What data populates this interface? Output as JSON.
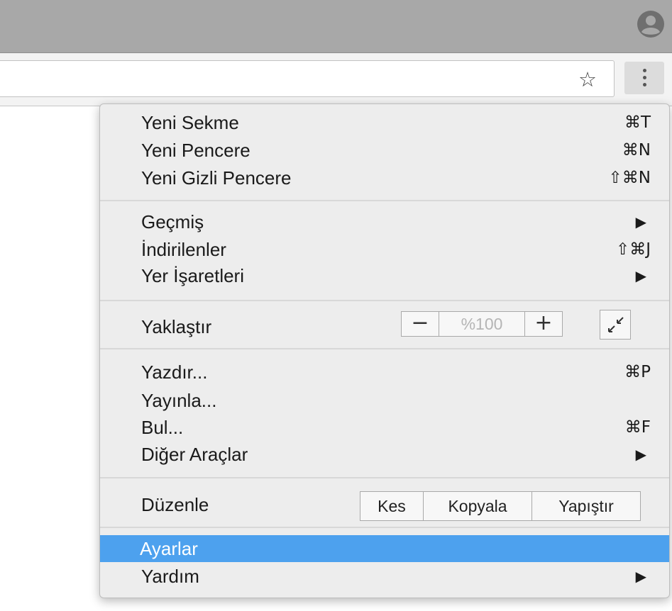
{
  "icons": {
    "profile": "account-circle-icon",
    "bookmark": "star-outline-icon",
    "menu": "vertical-dots-icon",
    "submenu": "triangle-right-icon",
    "fullscreen": "fullscreen-icon"
  },
  "toolbar": {
    "star_glyph": "☆"
  },
  "menu": {
    "section1": [
      {
        "label": "Yeni Sekme",
        "shortcut": "⌘T"
      },
      {
        "label": "Yeni Pencere",
        "shortcut": "⌘N"
      },
      {
        "label": "Yeni Gizli Pencere",
        "shortcut": "⇧⌘N"
      }
    ],
    "section2": [
      {
        "label": "Geçmiş",
        "arrow": "▶"
      },
      {
        "label": "İndirilenler",
        "shortcut": "⇧⌘J"
      },
      {
        "label": "Yer İşaretleri",
        "arrow": "▶"
      }
    ],
    "zoom": {
      "label": "Yaklaştır",
      "minus": "−",
      "value": "%100",
      "plus": "+"
    },
    "section3": [
      {
        "label": "Yazdır...",
        "shortcut": "⌘P"
      },
      {
        "label": "Yayınla..."
      },
      {
        "label": "Bul...",
        "shortcut": "⌘F"
      },
      {
        "label": "Diğer Araçlar",
        "arrow": "▶"
      }
    ],
    "edit": {
      "label": "Düzenle",
      "cut": "Kes",
      "copy": "Kopyala",
      "paste": "Yapıştır"
    },
    "section4": [
      {
        "label": "Ayarlar",
        "highlighted": true
      },
      {
        "label": "Yardım",
        "arrow": "▶"
      }
    ]
  },
  "colors": {
    "titlebar": "#a8a8a8",
    "menu_bg": "#ededed",
    "highlight": "#4da1ee"
  }
}
